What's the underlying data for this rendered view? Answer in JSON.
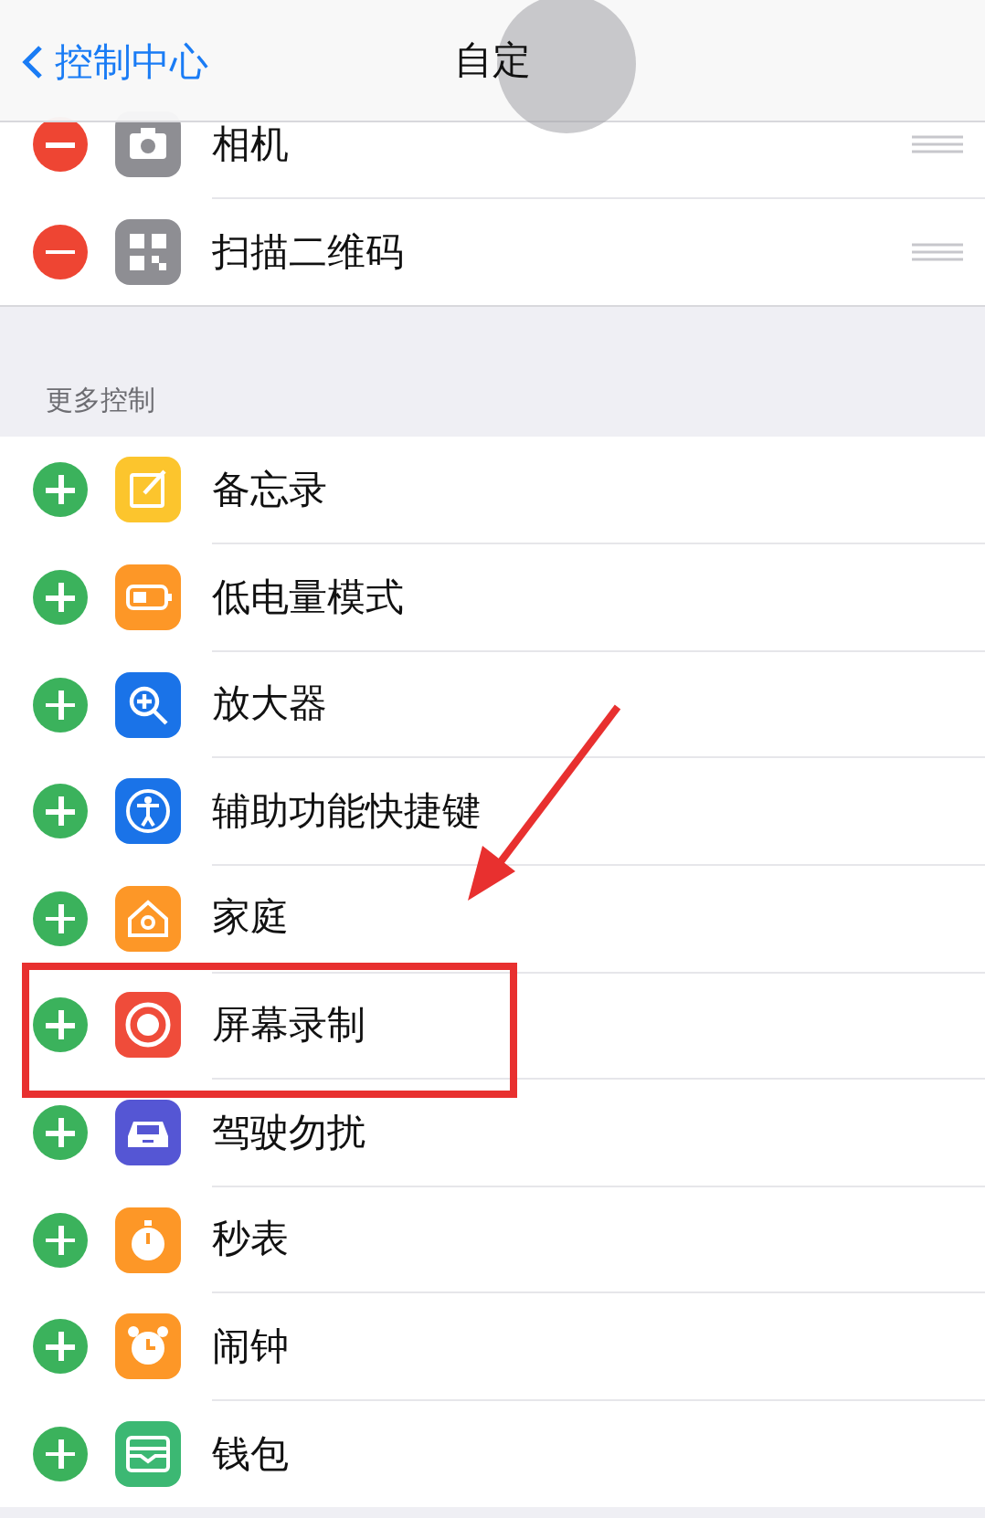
{
  "nav": {
    "back": "控制中心",
    "title": "自定"
  },
  "included": [
    {
      "label": "相机",
      "kind": "camera",
      "color": "#8e8e93"
    },
    {
      "label": "扫描二维码",
      "kind": "qrcode",
      "color": "#8e8e93"
    }
  ],
  "section_header": "更多控制",
  "more": [
    {
      "label": "备忘录",
      "kind": "notes",
      "color": "#fcc52d",
      "highlighted": false
    },
    {
      "label": "低电量模式",
      "kind": "battery",
      "color": "#fd9727",
      "highlighted": false
    },
    {
      "label": "放大器",
      "kind": "magnifier",
      "color": "#1a73e8",
      "highlighted": false
    },
    {
      "label": "辅助功能快捷键",
      "kind": "accessibility",
      "color": "#1a73e8",
      "highlighted": false
    },
    {
      "label": "家庭",
      "kind": "home",
      "color": "#fd9727",
      "highlighted": false
    },
    {
      "label": "屏幕录制",
      "kind": "record",
      "color": "#ef4c3a",
      "highlighted": true
    },
    {
      "label": "驾驶勿扰",
      "kind": "car",
      "color": "#5556d4",
      "highlighted": false
    },
    {
      "label": "秒表",
      "kind": "stopwatch",
      "color": "#fd9727",
      "highlighted": false
    },
    {
      "label": "闹钟",
      "kind": "alarm",
      "color": "#fd9727",
      "highlighted": false
    },
    {
      "label": "钱包",
      "kind": "wallet",
      "color": "#3cb873",
      "highlighted": false
    }
  ]
}
